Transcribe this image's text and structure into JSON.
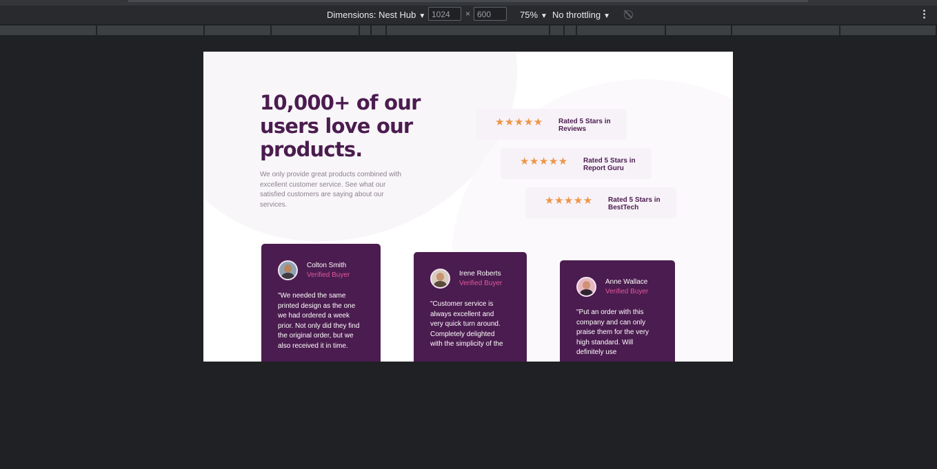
{
  "devtools": {
    "device_label": "Dimensions: Nest Hub",
    "width_value": "1024",
    "height_value": "600",
    "times": "×",
    "zoom": "75%",
    "throttling": "No throttling",
    "icons": [
      "rotate-icon",
      "kebab-menu-icon"
    ]
  },
  "page": {
    "headline": "10,000+ of our users love our products.",
    "lead": "We only provide great products combined with excellent customer service. See what our satisfied customers are saying about our services.",
    "ratings": [
      {
        "stars": "★★★★★",
        "text": "Rated 5 Stars in Reviews"
      },
      {
        "stars": "★★★★★",
        "text": "Rated 5 Stars in Report Guru"
      },
      {
        "stars": "★★★★★",
        "text": "Rated 5 Stars in BestTech"
      }
    ],
    "testimonials": [
      {
        "name": "Colton Smith",
        "badge": "Verified Buyer",
        "quote": "\"We needed the same printed design as the one we had ordered a week prior. Not only did they find the original order, but we also received it in time."
      },
      {
        "name": "Irene Roberts",
        "badge": "Verified Buyer",
        "quote": "\"Customer service is always excellent and very quick turn around. Completely delighted with the simplicity of the"
      },
      {
        "name": "Anne Wallace",
        "badge": "Verified Buyer",
        "quote": "\"Put an order with this company and can only praise them for the very high standard. Will definitely use"
      }
    ]
  },
  "colors": {
    "purple": "#4b1c4f",
    "pink": "#e0589f",
    "star": "#ee9546",
    "rating_bg": "#f7f2f8",
    "devtools_bg": "#292a2d"
  }
}
